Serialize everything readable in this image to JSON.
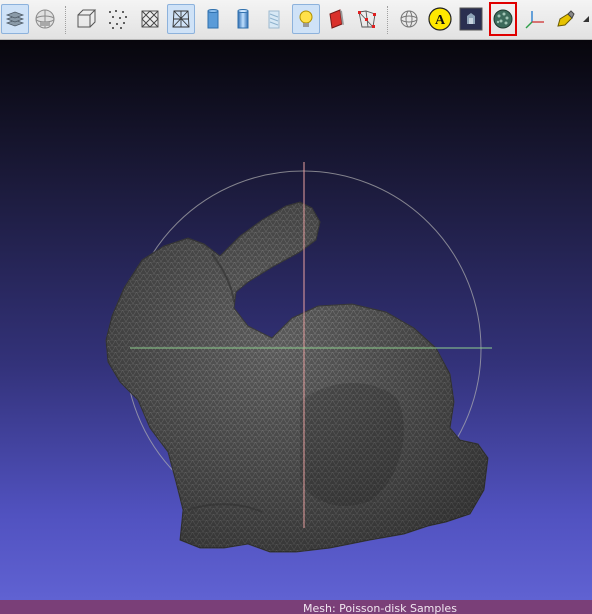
{
  "toolbar": {
    "buttons": [
      {
        "icon": "layers-icon"
      },
      {
        "icon": "light-sphere-icon"
      },
      {
        "icon": "bounding-box-icon"
      },
      {
        "icon": "points-icon"
      },
      {
        "icon": "wireframe-icon"
      },
      {
        "icon": "hidden-lines-icon"
      },
      {
        "icon": "flat-shading-icon"
      },
      {
        "icon": "smooth-shading-icon"
      },
      {
        "icon": "texture-icon"
      },
      {
        "icon": "lighting-bulb-icon"
      },
      {
        "icon": "backface-icon"
      },
      {
        "icon": "select-vertices-icon"
      },
      {
        "icon": "trackball-icon"
      },
      {
        "icon": "label-icon",
        "text": "A"
      },
      {
        "icon": "info-pane-icon"
      },
      {
        "icon": "raster-layers-icon"
      },
      {
        "icon": "axes-icon"
      },
      {
        "icon": "edit-icon"
      }
    ],
    "active": [
      "layers-icon",
      "hidden-lines-icon",
      "lighting-bulb-icon"
    ],
    "highlighted": "raster-layers-icon"
  },
  "viewport": {
    "mesh_color": "#5a5a5a",
    "trackball_colors": {
      "vertical": "#e8a0a0",
      "horizontal": "#8fd08f",
      "circle": "#b0b0b0"
    },
    "background_top": "#07060c",
    "background_bottom": "#6062d2"
  },
  "status": {
    "mesh_label": "Mesh: Poisson-disk Samples"
  },
  "colors": {
    "statusbar": "#7a3f78",
    "highlight_border": "#e00000"
  }
}
